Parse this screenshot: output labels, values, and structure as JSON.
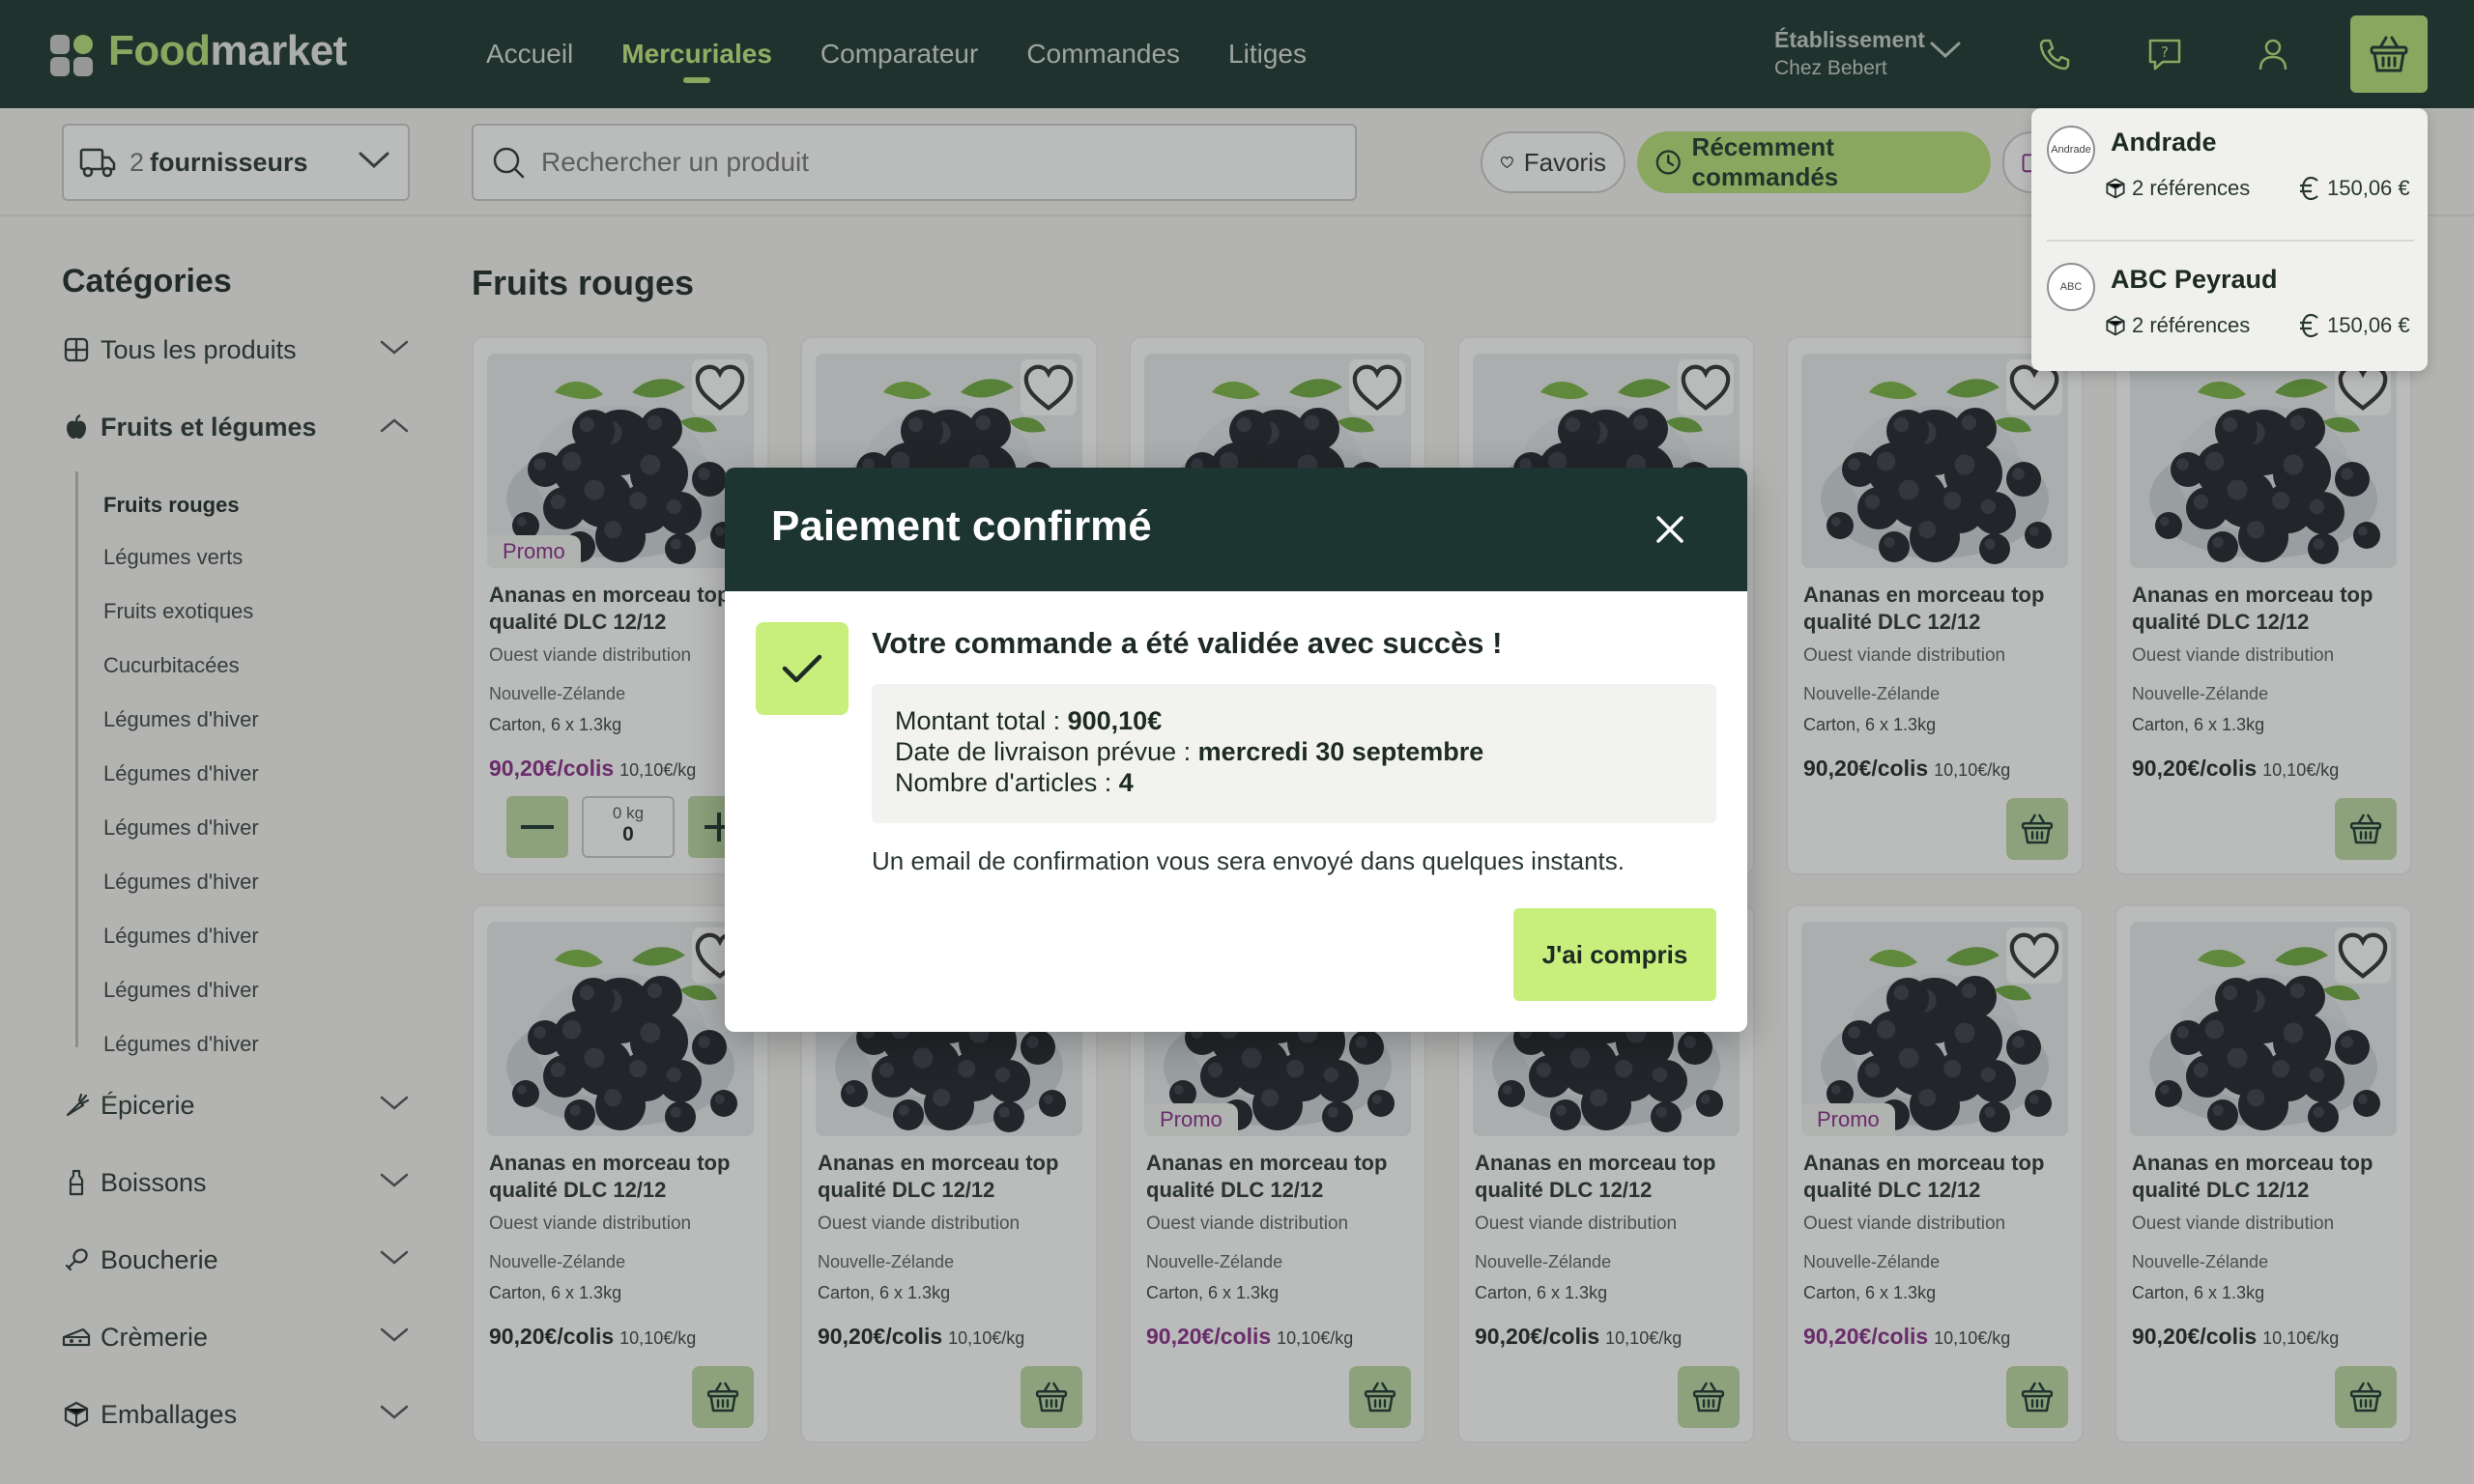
{
  "brand": {
    "part1": "Food",
    "part2": "market"
  },
  "nav": {
    "items": [
      {
        "label": "Accueil"
      },
      {
        "label": "Mercuriales",
        "active": true
      },
      {
        "label": "Comparateur"
      },
      {
        "label": "Commandes"
      },
      {
        "label": "Litiges"
      }
    ],
    "establishment_label": "Établissement",
    "establishment_name": "Chez Bebert",
    "icons": [
      "phone-icon",
      "help-chat-icon",
      "user-icon",
      "basket-icon"
    ]
  },
  "toolbar": {
    "supplier_count": "2",
    "supplier_label": "fournisseurs",
    "search_placeholder": "Rechercher un produit",
    "favorites_label": "Favoris",
    "recent_label": "Récemment commandés"
  },
  "sidebar": {
    "title": "Catégories",
    "categories": [
      {
        "label": "Tous les produits",
        "icon": "grid-icon"
      },
      {
        "label": "Fruits et légumes",
        "icon": "apple-icon",
        "open": true
      },
      {
        "label": "Épicerie",
        "icon": "carrot-icon"
      },
      {
        "label": "Boissons",
        "icon": "bottle-icon"
      },
      {
        "label": "Boucherie",
        "icon": "drumstick-icon"
      },
      {
        "label": "Crèmerie",
        "icon": "cheese-icon"
      },
      {
        "label": "Emballages",
        "icon": "package-icon"
      }
    ],
    "subcategories": [
      {
        "label": "Fruits rouges",
        "active": true
      },
      {
        "label": "Légumes verts"
      },
      {
        "label": "Fruits exotiques"
      },
      {
        "label": "Cucurbitacées"
      },
      {
        "label": "Légumes d'hiver"
      },
      {
        "label": "Légumes d'hiver"
      },
      {
        "label": "Légumes d'hiver"
      },
      {
        "label": "Légumes d'hiver"
      },
      {
        "label": "Légumes d'hiver"
      },
      {
        "label": "Légumes d'hiver"
      },
      {
        "label": "Légumes d'hiver"
      }
    ]
  },
  "main": {
    "title": "Fruits rouges",
    "product_template": {
      "title": "Ananas en morceau top qualité DLC 12/12",
      "brand": "Ouest viande distribution",
      "origin": "Nouvelle-Zélande",
      "pack": "Carton, 6 x 1.3kg",
      "price": "90,20€/colis",
      "unit_price": "10,10€/kg",
      "promo_label": "Promo"
    },
    "products": [
      {
        "promo": true,
        "stepper": true,
        "qty_unit": "0 kg",
        "qty_value": "0"
      },
      {
        "promo": false
      },
      {
        "promo": false
      },
      {
        "promo": false
      },
      {
        "promo": false
      },
      {
        "promo": false
      },
      {
        "promo": false
      },
      {
        "promo": false
      },
      {
        "promo": true
      },
      {
        "promo": false
      },
      {
        "promo": true
      },
      {
        "promo": false
      }
    ]
  },
  "supplier_panel": [
    {
      "name": "Andrade",
      "logo": "Andrade",
      "refs": "2 références",
      "amount": "150,06 €"
    },
    {
      "name": "ABC Peyraud",
      "logo": "ABC",
      "refs": "2 références",
      "amount": "150,06 €"
    }
  ],
  "modal": {
    "title": "Paiement confirmé",
    "message": "Votre commande a été validée avec succès !",
    "total_label": "Montant total : ",
    "total_value": "900,10€",
    "delivery_label": "Date de livraison prévue : ",
    "delivery_value": "mercredi 30 septembre",
    "items_label": "Nombre d'articles : ",
    "items_value": "4",
    "note": "Un email de confirmation vous sera envoyé dans quelques instants.",
    "confirm_label": "J'ai compris"
  },
  "colors": {
    "dark": "#1c3530",
    "accent": "#b8e27a",
    "promo": "#8a2d8a"
  }
}
